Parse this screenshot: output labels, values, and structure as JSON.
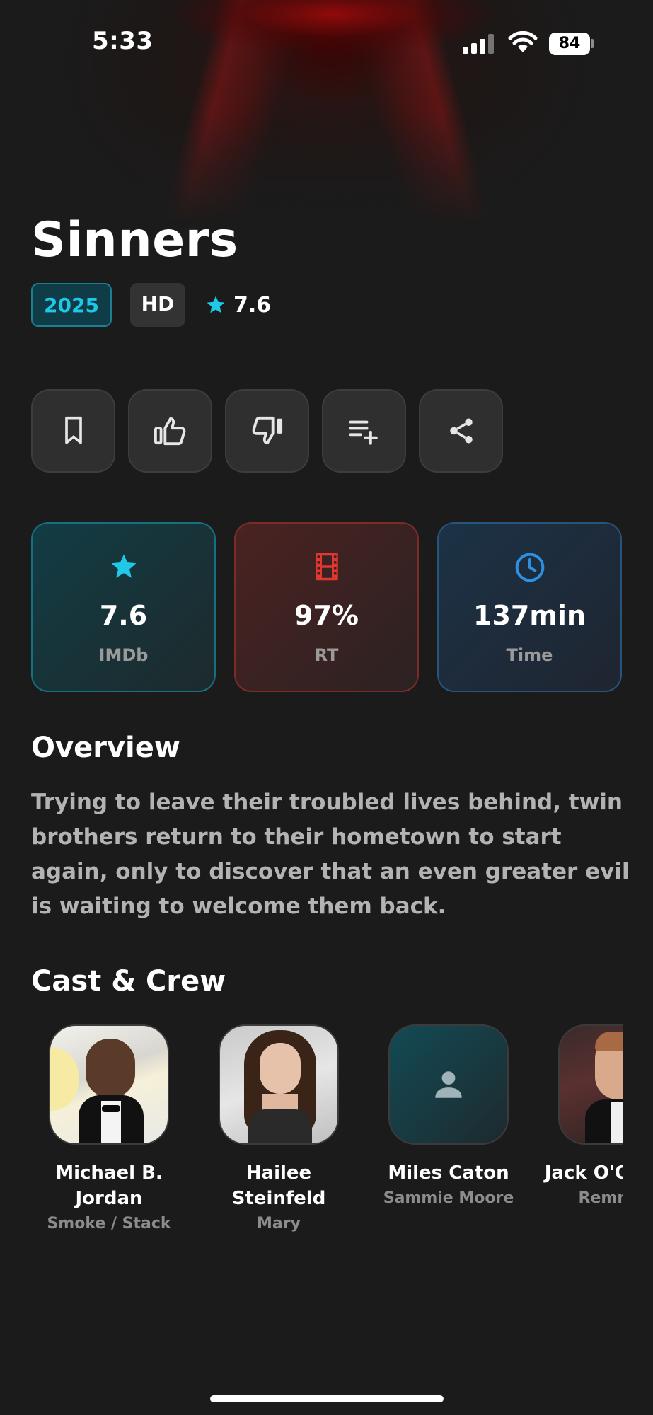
{
  "status_bar": {
    "time": "5:33",
    "battery": "84"
  },
  "movie": {
    "title": "Sinners",
    "year": "2025",
    "quality": "HD",
    "rating": "7.6"
  },
  "actions": [
    {
      "icon": "bookmark-icon"
    },
    {
      "icon": "thumbs-up-icon"
    },
    {
      "icon": "thumbs-down-icon"
    },
    {
      "icon": "playlist-add-icon"
    },
    {
      "icon": "share-icon"
    }
  ],
  "stats": {
    "imdb": {
      "value": "7.6",
      "label": "IMDb",
      "icon": "star-icon",
      "color": "#1fc8e6"
    },
    "rt": {
      "value": "97%",
      "label": "RT",
      "icon": "film-icon",
      "color": "#e0372e"
    },
    "time": {
      "value": "137min",
      "label": "Time",
      "icon": "clock-icon",
      "color": "#2f8fe0"
    }
  },
  "overview": {
    "heading": "Overview",
    "text": "Trying to leave their troubled lives behind, twin brothers return to their hometown to start again, only to discover that an even greater evil is waiting to welcome them back."
  },
  "cast": {
    "heading": "Cast & Crew",
    "members": [
      {
        "name": "Michael B. Jordan",
        "role": "Smoke / Stack"
      },
      {
        "name": "Hailee Steinfeld",
        "role": "Mary"
      },
      {
        "name": "Miles Caton",
        "role": "Sammie Moore"
      },
      {
        "name": "Jack O'Connell",
        "role": "Remmick"
      }
    ]
  },
  "colors": {
    "accent": "#1fc8e6",
    "background": "#1b1b1b",
    "rt_red": "#e0372e",
    "time_blue": "#2f8fe0"
  }
}
